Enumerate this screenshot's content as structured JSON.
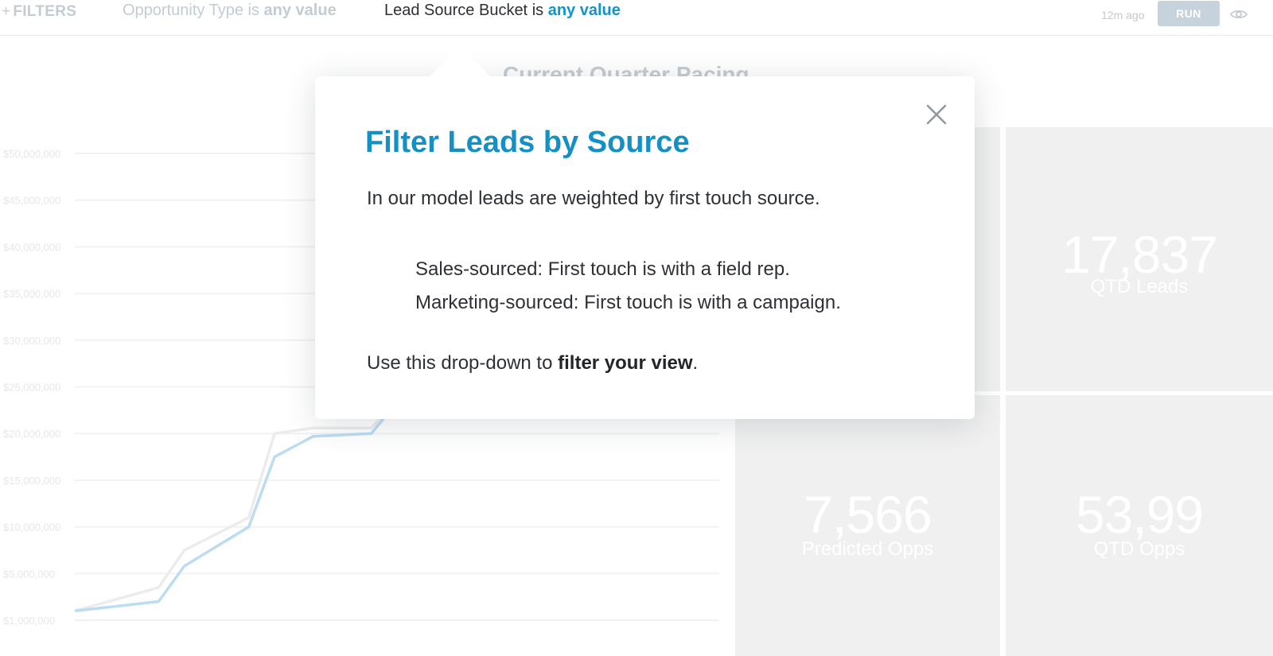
{
  "filter_bar": {
    "add_filters_label": "FILTERS",
    "filters": [
      {
        "field": "Opportunity Type",
        "operator": "is",
        "value": "any value"
      },
      {
        "field": "Lead Source Bucket",
        "operator": "is",
        "value": "any value"
      }
    ],
    "updated": "12m ago",
    "run_label": "RUN"
  },
  "dashboard": {
    "title": "Current Quarter Pacing",
    "tiles": [
      {
        "value": "17,837",
        "label": "QTD Leads"
      },
      {
        "value": "7,566",
        "label": "Predicted Opps"
      },
      {
        "value": "53,99",
        "label": "QTD Opps"
      }
    ]
  },
  "chart_data": {
    "type": "line",
    "y_ticks": [
      "$50,000,000",
      "$45,000,000",
      "$40,000,000",
      "$35,000,000",
      "$30,000,000",
      "$25,000,000",
      "$20,000,000",
      "$15,000,000",
      "$10,000,000",
      "$5,000,000",
      "$1,000,000"
    ],
    "series": [
      {
        "color": "#bcdcf2",
        "values": [
          1000000,
          2000000,
          5800000,
          10000000,
          17500000,
          19700000,
          20000000,
          25000000
        ]
      },
      {
        "color": "#ececec",
        "values": [
          1000000,
          3500000,
          7500000,
          11000000,
          20000000,
          20600000,
          20600000,
          25000000
        ]
      }
    ],
    "x_positions": [
      0,
      0.13,
      0.17,
      0.27,
      0.31,
      0.37,
      0.46,
      0.52
    ],
    "ylim": [
      0,
      50000000
    ],
    "grid": true
  },
  "modal": {
    "title": "Filter Leads by Source",
    "intro": "In our model leads are weighted by first touch source.",
    "items": [
      "Sales-sourced: First touch is with a field rep.",
      "Marketing-sourced: First touch is with a campaign."
    ],
    "footer_prefix": "Use this drop-down to ",
    "footer_bold": "filter your view",
    "footer_suffix": "."
  }
}
